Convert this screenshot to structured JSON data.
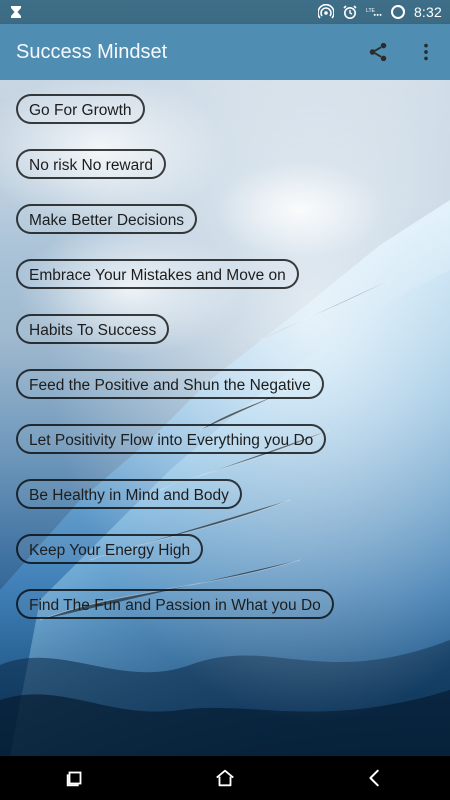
{
  "status_bar": {
    "time": "8:32",
    "icons": [
      "hourglass-icon",
      "hotspot-icon",
      "alarm-icon",
      "lte-signal-icon",
      "battery-icon"
    ]
  },
  "app_bar": {
    "title": "Success Mindset",
    "actions": [
      "share-icon",
      "overflow-menu-icon"
    ]
  },
  "list": {
    "items": [
      "Go For Growth",
      "No risk No reward",
      "Make Better Decisions",
      "Embrace Your Mistakes and Move on",
      "Habits To Success",
      "Feed the Positive and Shun the Negative",
      "Let Positivity Flow into Everything you Do",
      "Be Healthy in Mind and Body",
      "Keep Your Energy High",
      "Find The Fun and Passion in What you Do"
    ]
  },
  "nav_bar": {
    "buttons": [
      "recent-apps-icon",
      "home-icon",
      "back-icon"
    ]
  },
  "colors": {
    "app_bar": "#4f8db3",
    "status_bar": "#3f6f88",
    "nav_bar": "#000000",
    "pill_border": "#1d1d1d"
  }
}
